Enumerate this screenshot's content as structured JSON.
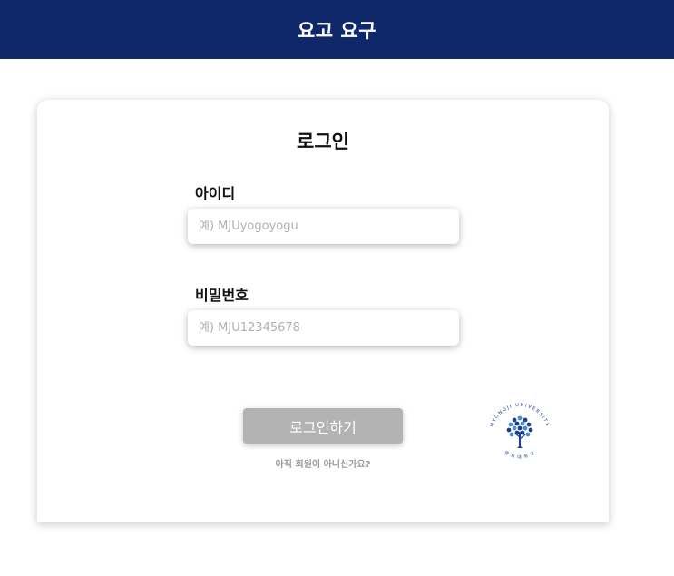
{
  "header": {
    "title": "요고 요구"
  },
  "login": {
    "title": "로그인",
    "id_label": "아이디",
    "id_placeholder": "예) MJUyogoyogu",
    "password_label": "비밀번호",
    "password_placeholder": "예) MJU12345678",
    "submit_label": "로그인하기",
    "signup_text": "아직 회원이 아니신가요?"
  },
  "logo": {
    "icon": "myongji-university-seal-icon",
    "ring_text_top": "MYONGJI UNIVERSITY",
    "ring_text_bottom": "명 지 대 학 교"
  },
  "colors": {
    "header_bg": "#0f2869",
    "button_bg": "#b3b3b3",
    "logo_blue": "#1f3f8f",
    "logo_light_blue": "#4a8fd6"
  }
}
